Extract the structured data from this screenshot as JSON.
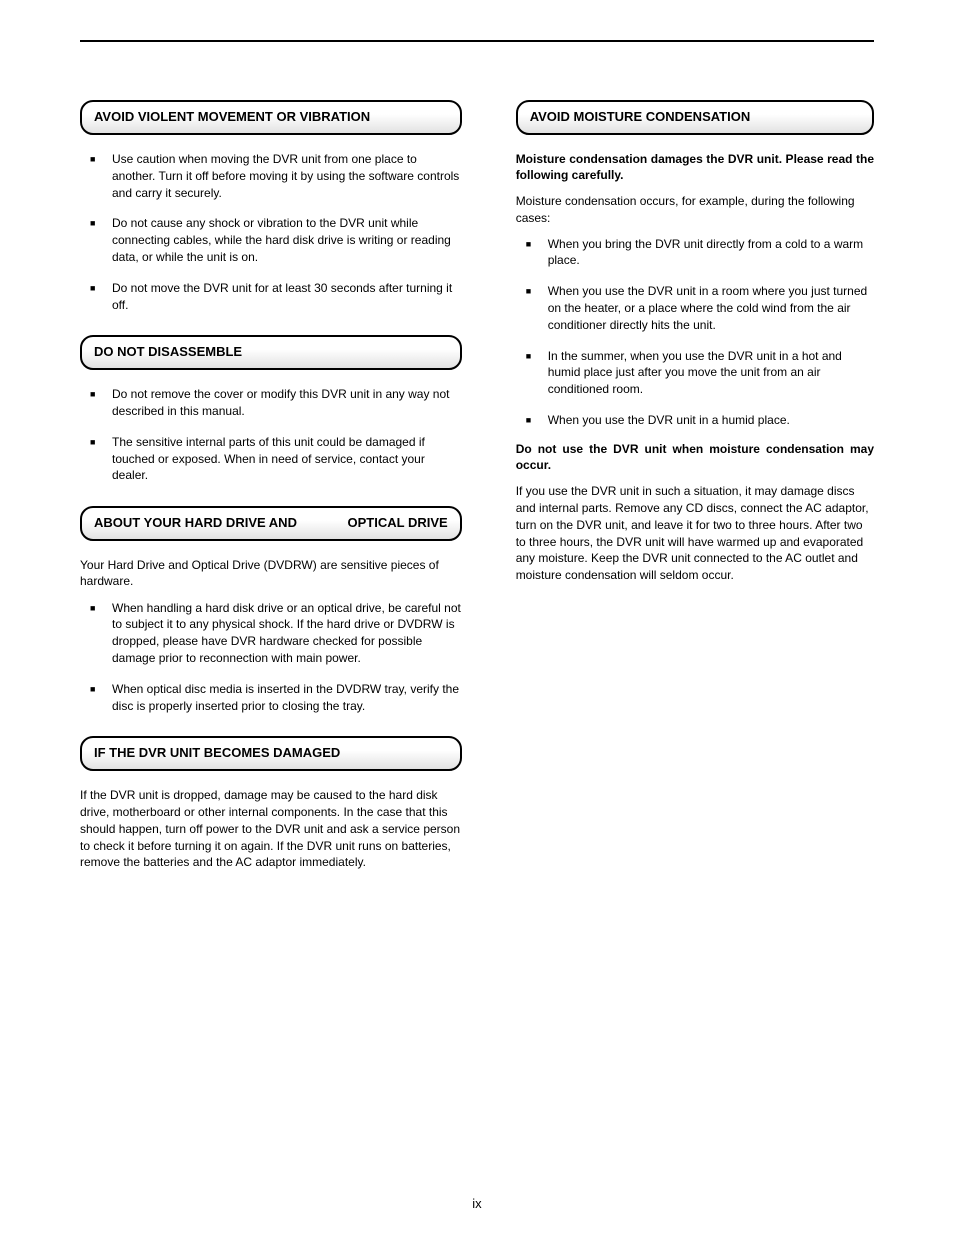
{
  "left": {
    "sec1": {
      "title": "AVOID VIOLENT MOVEMENT OR VIBRATION",
      "items": [
        "Use caution when moving the DVR unit from one place to another. Turn it off before moving it by using the software controls and carry it securely.",
        "Do not cause any shock or vibration to the DVR unit while connecting cables, while the hard disk drive is writing or reading data, or while the unit is on.",
        "Do not move the DVR unit for at least 30 seconds after turning it off."
      ]
    },
    "sec2": {
      "title": "DO NOT DISASSEMBLE",
      "items": [
        "Do not remove the cover or modify this DVR unit in any way not described in this manual.",
        "The sensitive internal parts of this unit could be damaged if touched or exposed. When in need of service, contact your dealer."
      ]
    },
    "sec3": {
      "title": "ABOUT YOUR HARD DRIVE AND              OPTICAL DRIVE",
      "intro": "Your Hard Drive and Optical Drive (DVDRW) are sensitive pieces of hardware.",
      "items": [
        "When handling a hard disk drive or an optical drive, be careful not to subject it to any physical shock. If the hard drive or DVDRW is dropped, please have DVR hardware checked for possible damage prior to reconnection with main power.",
        "When optical disc media is inserted in the DVDRW tray, verify the disc is properly inserted prior to closing the tray."
      ]
    },
    "sec4": {
      "title": "IF THE DVR UNIT BECOMES DAMAGED",
      "follow": "If the DVR unit is dropped, damage may be caused to the hard disk drive, motherboard or other internal components. In the case that this should happen, turn off power to the DVR unit and ask a service person to check it before turning it on again. If the DVR unit runs on batteries, remove the batteries and the AC adaptor immediately."
    }
  },
  "right": {
    "sec1": {
      "title": "AVOID MOISTURE CONDENSATION",
      "lead": "Moisture condensation damages the DVR unit. Please read the following carefully.",
      "introItems": "Moisture condensation occurs, for example, during the following cases:",
      "items": [
        "When you bring the DVR unit directly from a cold to a warm place.",
        "When you use the DVR unit in a room where you just turned on the heater, or a place where the cold wind from the air conditioner directly hits the unit.",
        "In the summer, when you use the DVR unit in a hot and humid place just after you move the unit from an air conditioned room.",
        "When you use the DVR unit in a humid place."
      ],
      "warn": "Do not use the DVR unit when moisture condensation may occur.",
      "follow": "If you use the DVR unit in such a situation, it may damage discs and internal parts. Remove any CD discs, connect the AC adaptor, turn on the DVR unit, and leave it for two to three hours. After two to three hours, the DVR unit will have warmed up and evaporated any moisture. Keep the DVR unit connected to the AC outlet and moisture condensation will seldom occur."
    }
  },
  "pageNumber": "ix"
}
